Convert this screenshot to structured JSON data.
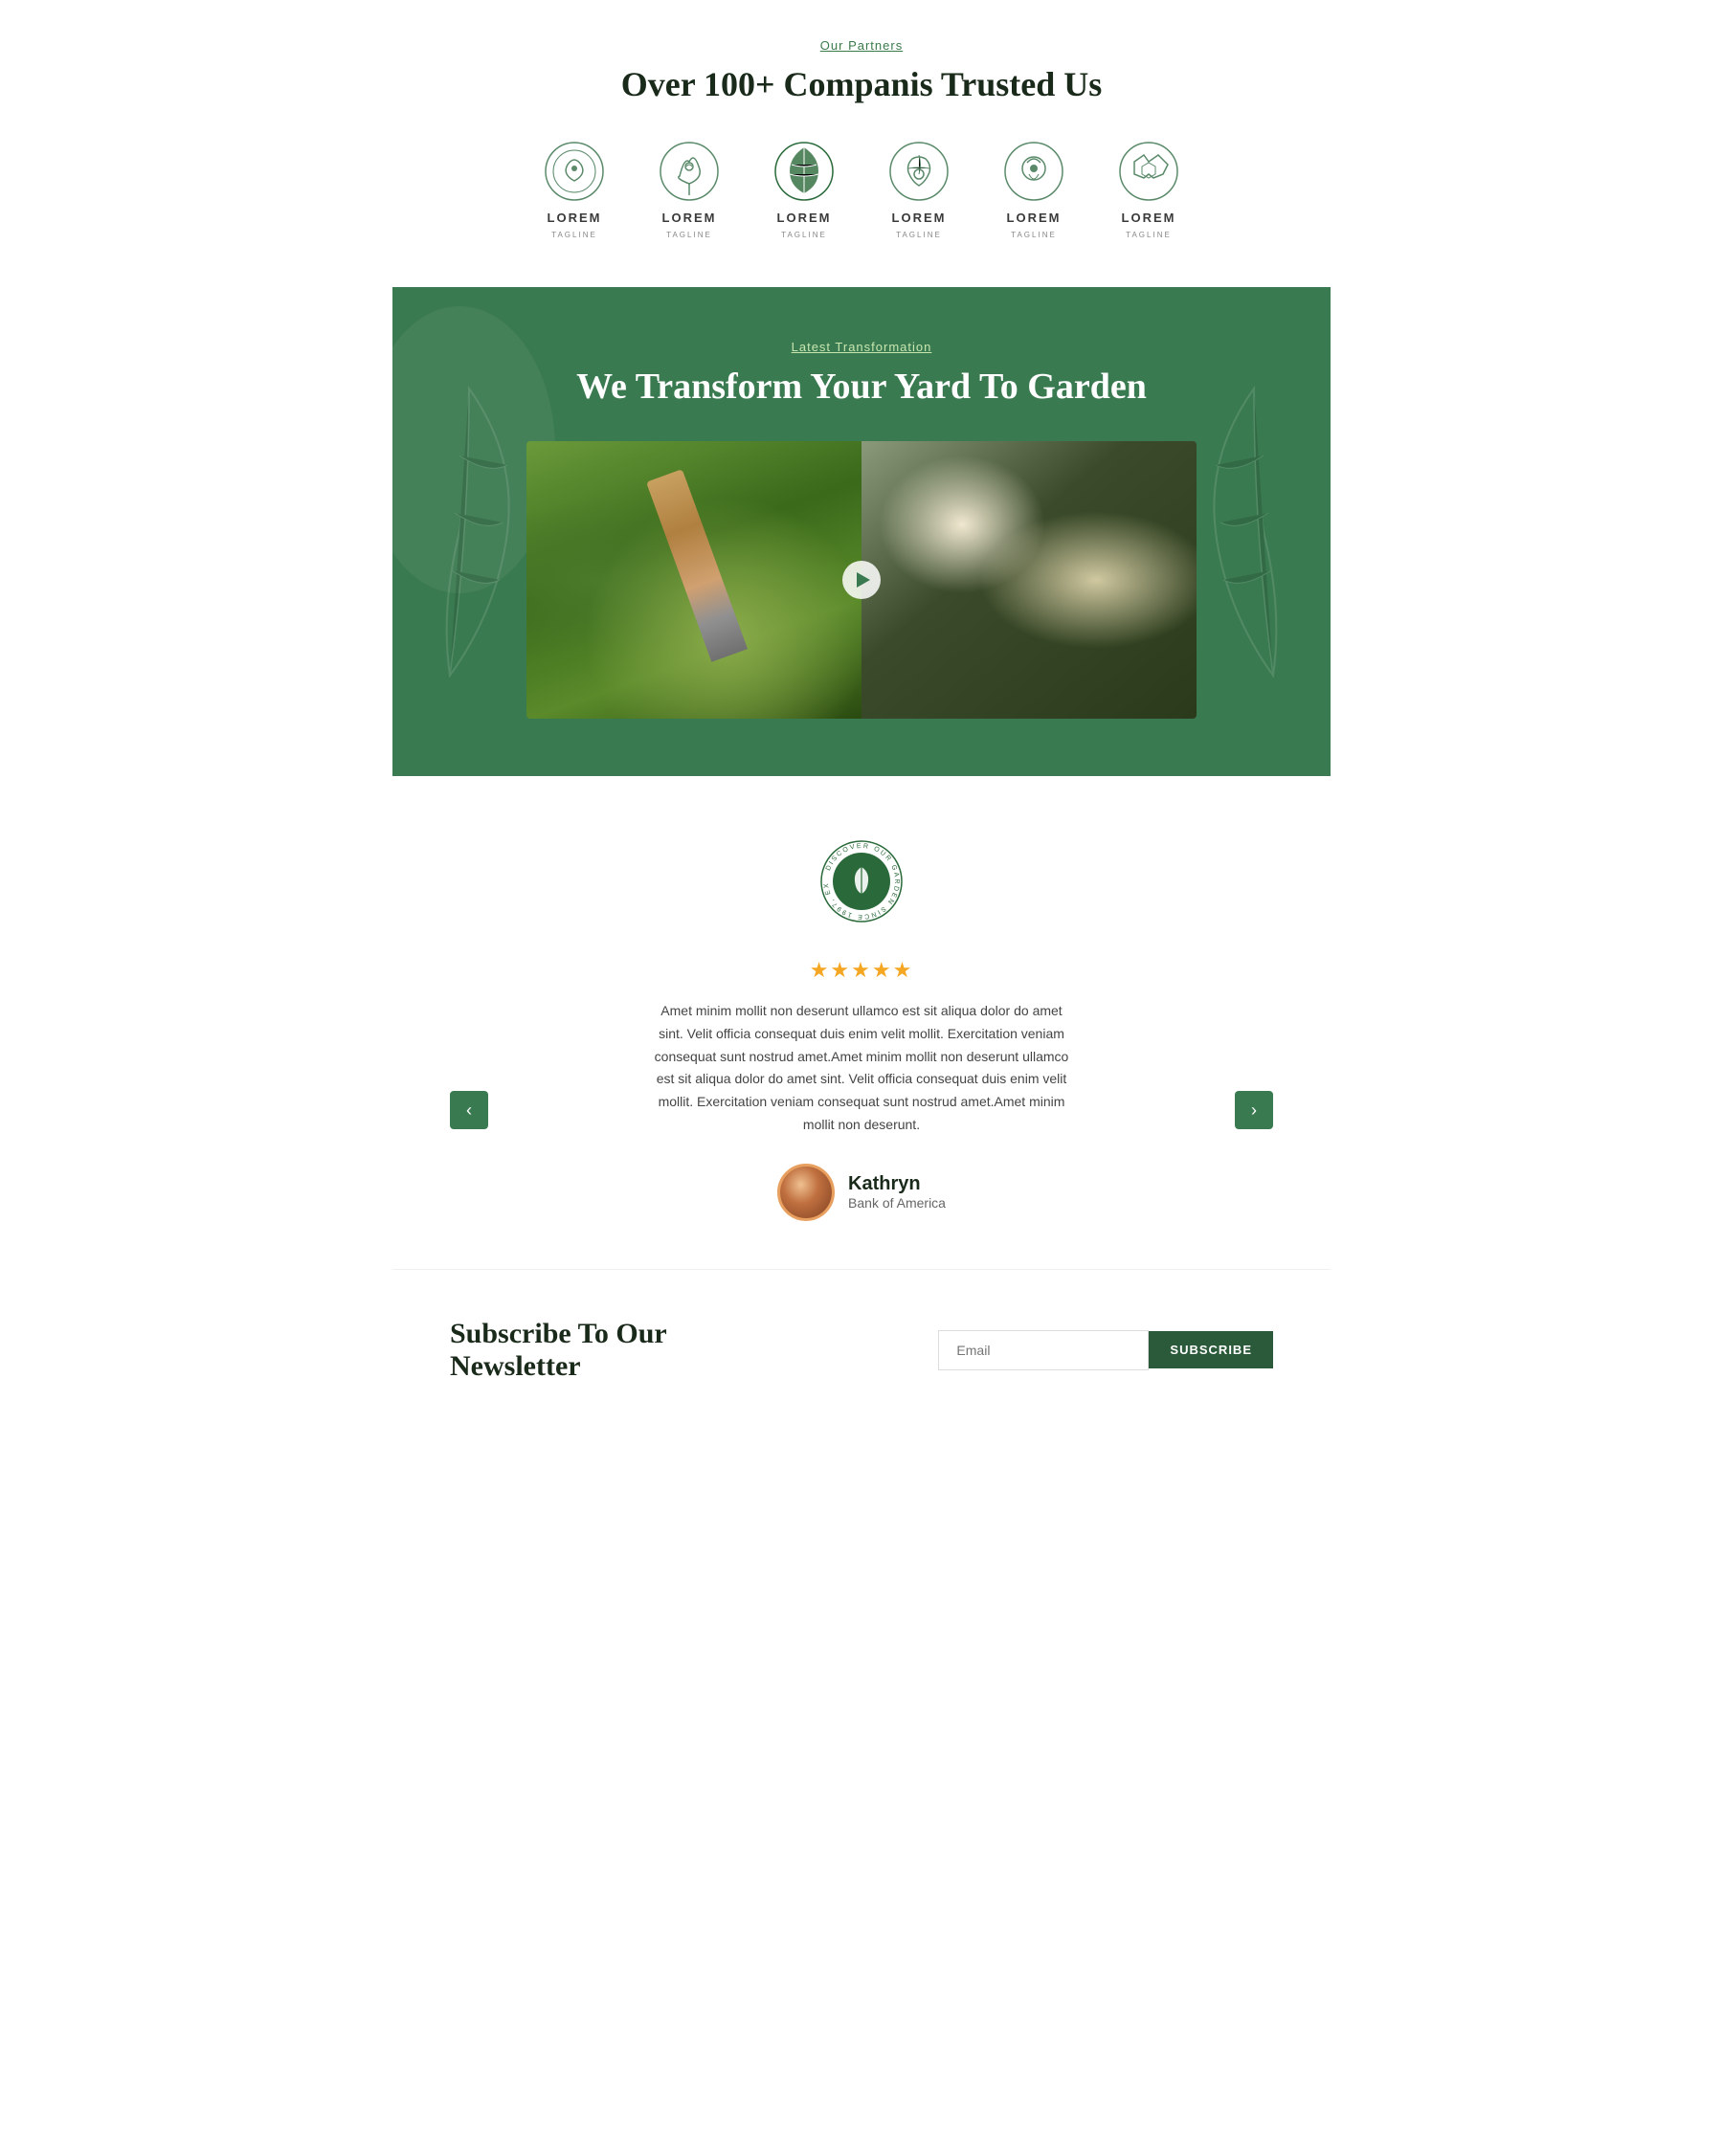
{
  "partners": {
    "label": "Our Partners",
    "title": "Over 100+ Companis Trusted Us",
    "logos": [
      {
        "name": "LOREM",
        "tagline": "TAGLINE"
      },
      {
        "name": "LOREM",
        "tagline": "TAGLINE"
      },
      {
        "name": "LOREM",
        "tagline": "TAGLINE"
      },
      {
        "name": "LOREM",
        "tagline": "TAGLINE"
      },
      {
        "name": "LOREM",
        "tagline": "TAGLINE"
      },
      {
        "name": "LOREM",
        "tagline": "TAGLINE"
      }
    ]
  },
  "transformation": {
    "label": "Latest Transformation",
    "title": "We Transform Your Yard To Garden"
  },
  "testimonial": {
    "stars": "★★★★★",
    "text": "Amet minim mollit non deserunt ullamco est sit aliqua dolor do amet sint. Velit officia consequat duis enim velit mollit. Exercitation veniam consequat sunt nostrud amet.Amet minim mollit non deserunt ullamco est sit aliqua dolor do amet sint. Velit officia consequat duis enim velit mollit. Exercitation veniam consequat sunt nostrud amet.Amet minim mollit non deserunt.",
    "author": {
      "name": "Kathryn",
      "company": "Bank of America"
    },
    "nav_prev": "‹",
    "nav_next": "›",
    "badge_text": "DISCOVER OUR GARDEN SINCE 1997, EXPLORE &"
  },
  "newsletter": {
    "title": "Subscribe To Our Newsletter",
    "input_placeholder": "Email",
    "button_label": "SUBSCRIBE"
  }
}
